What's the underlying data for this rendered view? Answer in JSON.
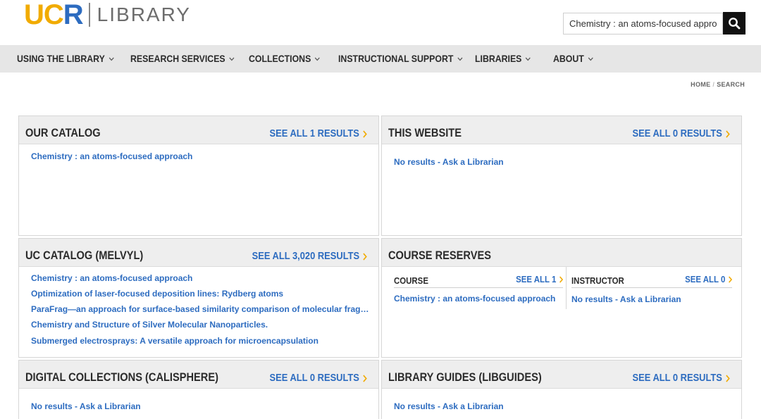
{
  "header": {
    "logo": {
      "u": "U",
      "c": "C",
      "r": "R",
      "library": "LIBRARY"
    },
    "search_value": "Chemistry : an atoms-focused appro",
    "search_icon": "search-icon"
  },
  "nav": [
    {
      "label": "USING THE LIBRARY"
    },
    {
      "label": "RESEARCH SERVICES"
    },
    {
      "label": "COLLECTIONS"
    },
    {
      "label": "INSTRUCTIONAL SUPPORT"
    },
    {
      "label": "LIBRARIES"
    },
    {
      "label": "ABOUT"
    }
  ],
  "breadcrumb": {
    "home": "HOME",
    "sep": "/",
    "current": "SEARCH"
  },
  "panels": {
    "our_catalog": {
      "title": "OUR CATALOG",
      "see_all": "SEE ALL 1 RESULTS",
      "results": [
        "Chemistry : an atoms-focused approach"
      ]
    },
    "this_website": {
      "title": "THIS WEBSITE",
      "see_all": "SEE ALL 0 RESULTS",
      "results": [
        "No results - Ask a Librarian"
      ]
    },
    "uc_catalog": {
      "title": "UC CATALOG (MELVYL)",
      "see_all": "SEE ALL 3,020 RESULTS",
      "results": [
        "Chemistry : an atoms-focused approach",
        "Optimization of laser-focused deposition lines: Rydberg atoms",
        "ParaFrag—an approach for surface-based similarity comparison of molecular fragm…",
        "Chemistry and Structure of Silver Molecular Nanoparticles.",
        "Submerged electrosprays: A versatile approach for microencapsulation"
      ]
    },
    "course_reserves": {
      "title": "COURSE RESERVES",
      "course": {
        "title": "COURSE",
        "see_all": "SEE ALL 1",
        "result": "Chemistry : an atoms-focused approach"
      },
      "instructor": {
        "title": "INSTRUCTOR",
        "see_all": "SEE ALL 0",
        "result": "No results - Ask a Librarian"
      }
    },
    "digital_collections": {
      "title": "DIGITAL COLLECTIONS (CALISPHERE)",
      "see_all": "SEE ALL 0 RESULTS",
      "results": [
        "No results - Ask a Librarian"
      ]
    },
    "library_guides": {
      "title": "LIBRARY GUIDES (LIBGUIDES)",
      "see_all": "SEE ALL 0 RESULTS",
      "results": [
        "No results - Ask a Librarian"
      ]
    }
  },
  "colors": {
    "link": "#2D6CC0",
    "accent": "#F1AB00",
    "nav_bg": "#e6e6e6",
    "panel_head_bg": "#eeeeee"
  }
}
